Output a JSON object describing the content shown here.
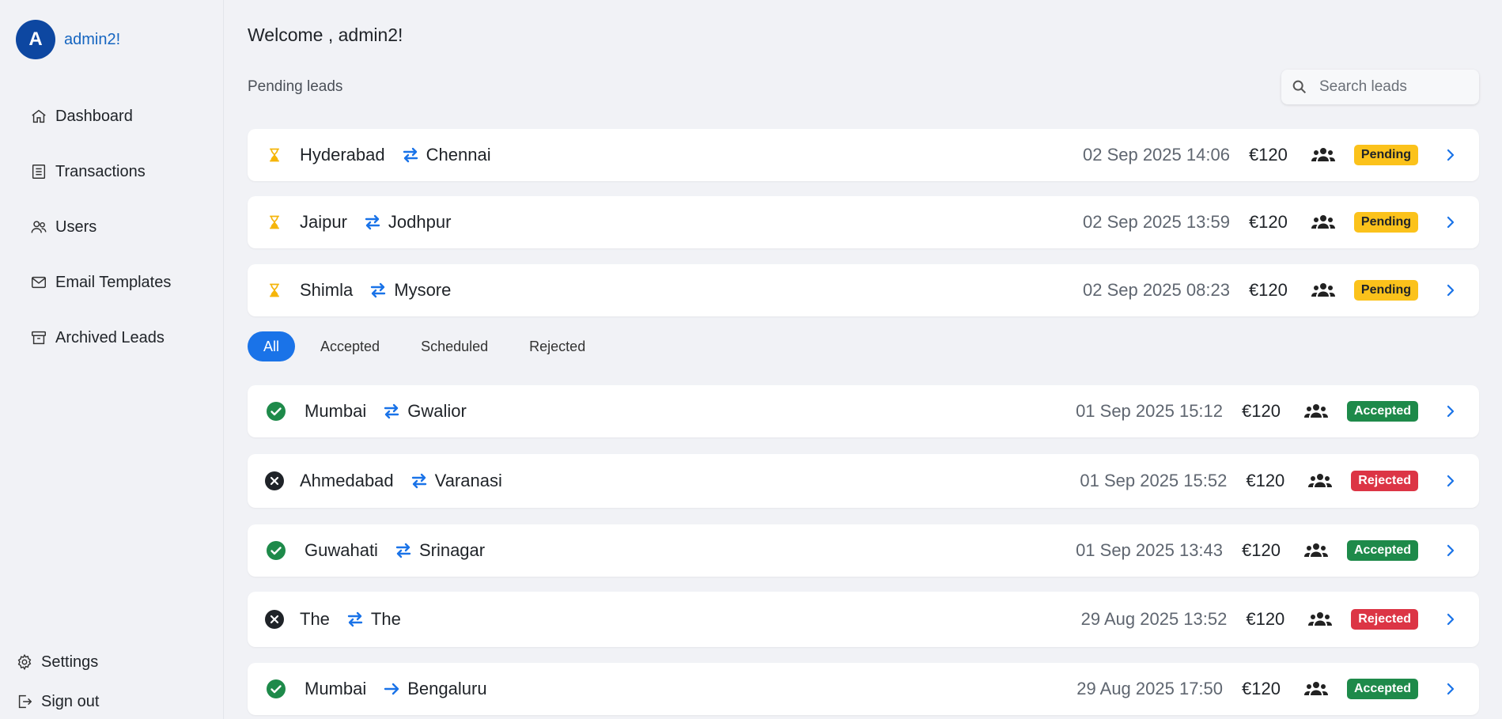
{
  "profile": {
    "initial": "A",
    "name": "admin2!"
  },
  "nav": {
    "dashboard": "Dashboard",
    "transactions": "Transactions",
    "users": "Users",
    "email_templates": "Email Templates",
    "archived_leads": "Archived Leads",
    "settings": "Settings",
    "sign_out": "Sign out"
  },
  "header": {
    "welcome": "Welcome , admin2!",
    "pending_title": "Pending leads",
    "search_placeholder": "Search leads"
  },
  "pending": [
    {
      "from": "Hyderabad",
      "to": "Chennai",
      "date": "02 Sep 2025 14:06",
      "price": "€120",
      "status": "Pending"
    },
    {
      "from": "Jaipur",
      "to": "Jodhpur",
      "date": "02 Sep 2025 13:59",
      "price": "€120",
      "status": "Pending"
    },
    {
      "from": "Shimla",
      "to": "Mysore",
      "date": "02 Sep 2025 08:23",
      "price": "€120",
      "status": "Pending"
    }
  ],
  "filters": {
    "all": "All",
    "accepted": "Accepted",
    "scheduled": "Scheduled",
    "rejected": "Rejected",
    "active": "All"
  },
  "leads": [
    {
      "from": "Mumbai",
      "to": "Gwalior",
      "date": "01 Sep 2025 15:12",
      "price": "€120",
      "status": "Accepted",
      "route_icon": "swap-icon"
    },
    {
      "from": "Ahmedabad",
      "to": "Varanasi",
      "date": "01 Sep 2025 15:52",
      "price": "€120",
      "status": "Rejected",
      "route_icon": "swap-icon"
    },
    {
      "from": "Guwahati",
      "to": "Srinagar",
      "date": "01 Sep 2025 13:43",
      "price": "€120",
      "status": "Accepted",
      "route_icon": "swap-icon"
    },
    {
      "from": "The",
      "to": "The",
      "date": "29 Aug 2025 13:52",
      "price": "€120",
      "status": "Rejected",
      "route_icon": "swap-icon"
    },
    {
      "from": "Mumbai",
      "to": "Bengaluru",
      "date": "29 Aug 2025 17:50",
      "price": "€120",
      "status": "Accepted",
      "route_icon": "arrow-right-icon"
    }
  ],
  "colors": {
    "accent": "#1a73e8",
    "pending": "#fbc21b",
    "accepted": "#1e8a4a",
    "rejected": "#dc3545",
    "avatar": "#0d47a1"
  }
}
